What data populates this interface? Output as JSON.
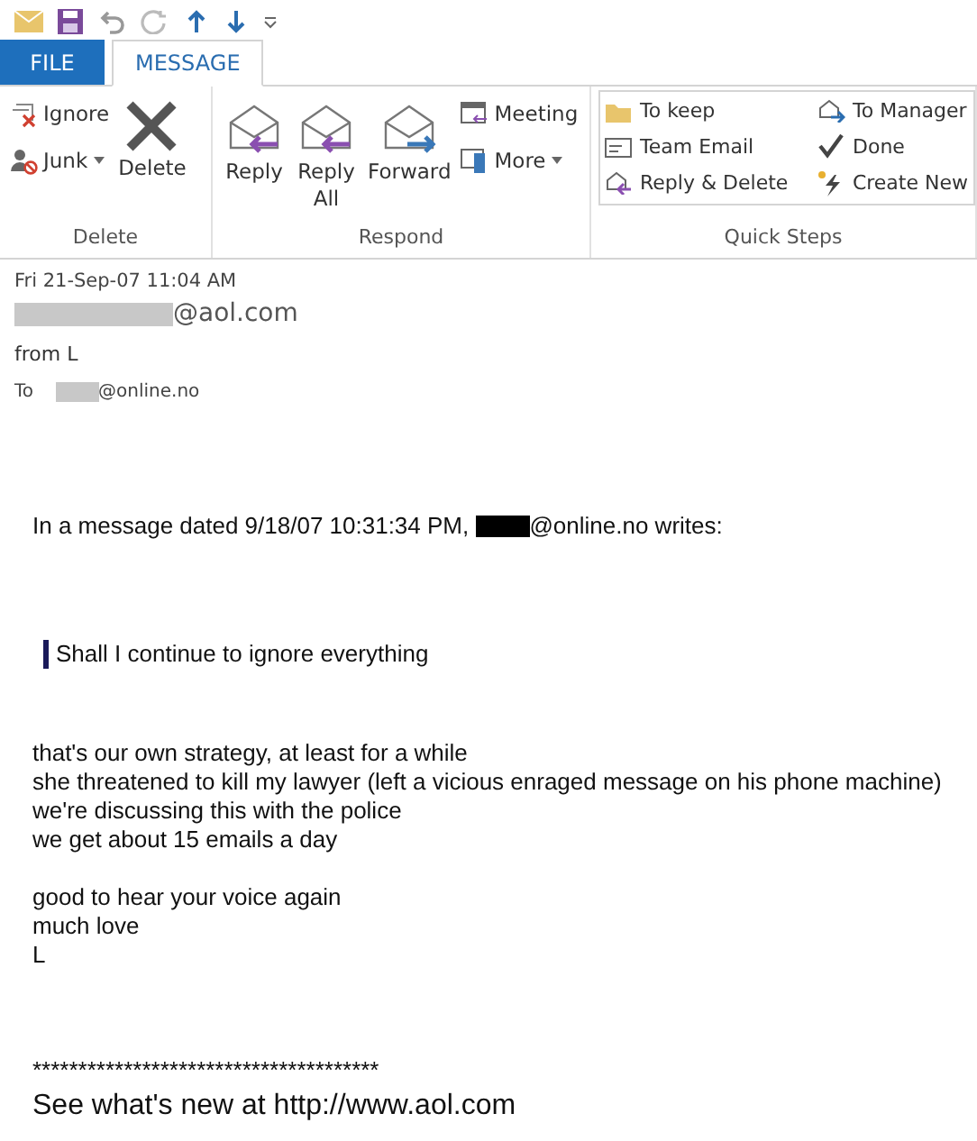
{
  "tabs": [
    {
      "label": "FILE",
      "kind": "file",
      "selected": false
    },
    {
      "label": "MESSAGE",
      "kind": "tab",
      "selected": true
    }
  ],
  "ribbon": {
    "delete_group": {
      "label": "Delete",
      "ignore": "Ignore",
      "junk": "Junk",
      "delete": "Delete"
    },
    "respond_group": {
      "label": "Respond",
      "reply": "Reply",
      "reply_all": [
        "Reply",
        "All"
      ],
      "forward": "Forward",
      "meeting": "Meeting",
      "more": "More"
    },
    "quick_steps": {
      "label": "Quick Steps",
      "items": [
        "To keep",
        "To Manager",
        "Team Email",
        "Done",
        "Reply & Delete",
        "Create New"
      ]
    }
  },
  "message": {
    "date": "Fri 21-Sep-07 11:04 AM",
    "from": "@aol.com",
    "subject": "from L",
    "to_label": "To",
    "to": "@online.no",
    "intro_before": "In a message dated 9/18/07 10:31:34 PM, ",
    "intro_after": "@online.no writes:",
    "quote": "Shall I continue to ignore everything",
    "paragraphs": [
      [
        "that's our own strategy, at least for a while",
        "she threatened to kill my lawyer (left a vicious enraged message on his phone machine)",
        "we're discussing this with the police",
        "we get about 15 emails a day"
      ],
      [
        "good to hear your voice again",
        "much love",
        "L"
      ]
    ],
    "divider": "**************************************",
    "footer": "See what's new at http://www.aol.com"
  }
}
